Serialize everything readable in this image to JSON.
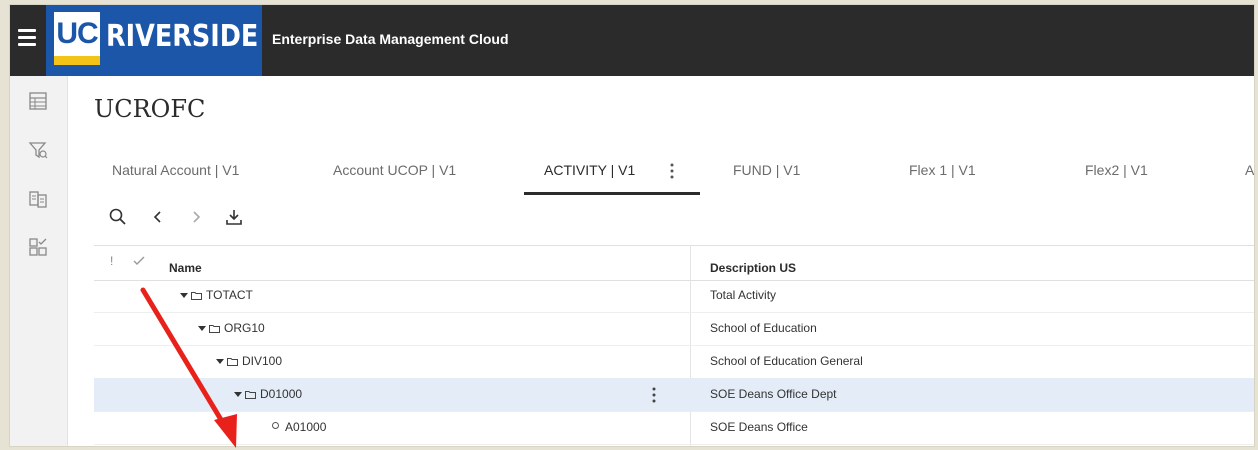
{
  "header": {
    "logo_uc": "UC",
    "logo_name": "RIVERSIDE",
    "app_title": "Enterprise Data Management Cloud"
  },
  "page": {
    "title": "UCROFC"
  },
  "tabs": [
    {
      "label": "Natural Account | V1",
      "active": false
    },
    {
      "label": "Account UCOP | V1",
      "active": false
    },
    {
      "label": "ACTIVITY | V1",
      "active": true
    },
    {
      "label": "FUND | V1",
      "active": false
    },
    {
      "label": "Flex 1 | V1",
      "active": false
    },
    {
      "label": "Flex2 | V1",
      "active": false
    },
    {
      "label": "A",
      "active": false
    }
  ],
  "table": {
    "columns": {
      "flag": "!",
      "name": "Name",
      "description": "Description US"
    },
    "rows": [
      {
        "name": "TOTACT",
        "description": "Total Activity",
        "type": "folder",
        "selected": false
      },
      {
        "name": "ORG10",
        "description": "School of Education",
        "type": "folder",
        "selected": false
      },
      {
        "name": "DIV100",
        "description": "School of Education General",
        "type": "folder",
        "selected": false
      },
      {
        "name": "D01000",
        "description": "SOE Deans Office Dept",
        "type": "folder",
        "selected": true
      },
      {
        "name": "A01000",
        "description": "SOE Deans Office",
        "type": "leaf",
        "selected": false
      }
    ]
  },
  "colors": {
    "header_bg": "#2b2b2b",
    "brand_blue": "#1b56a8",
    "brand_gold": "#f3c317",
    "selected_row": "#e3ecf7",
    "annotation_arrow": "#e8221b"
  },
  "icons": {
    "menu": "hamburger-icon",
    "rail": [
      "table-view-icon",
      "filter-icon",
      "compare-icon",
      "checklist-icon"
    ],
    "toolbar": [
      "search-icon",
      "chevron-left-icon",
      "chevron-right-icon",
      "download-icon"
    ]
  }
}
